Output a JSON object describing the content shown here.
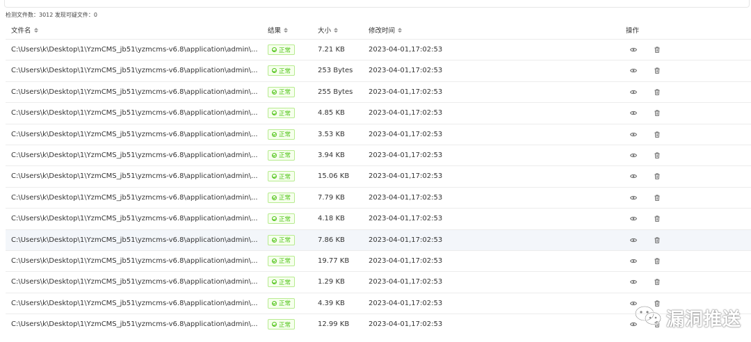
{
  "summary": "检测文件数：3012 发现可疑文件：0",
  "columns": {
    "name": "文件名",
    "result": "结果",
    "size": "大小",
    "time": "修改时间",
    "ops": "操作"
  },
  "rows": [
    {
      "path": "C:\\Users\\k\\Desktop\\1\\YzmCMS_jb51\\yzmcms-v6.8\\application\\admin\\...",
      "result": "正常",
      "size": "7.21 KB",
      "time": "2023-04-01,17:02:53"
    },
    {
      "path": "C:\\Users\\k\\Desktop\\1\\YzmCMS_jb51\\yzmcms-v6.8\\application\\admin\\...",
      "result": "正常",
      "size": "253 Bytes",
      "time": "2023-04-01,17:02:53"
    },
    {
      "path": "C:\\Users\\k\\Desktop\\1\\YzmCMS_jb51\\yzmcms-v6.8\\application\\admin\\...",
      "result": "正常",
      "size": "255 Bytes",
      "time": "2023-04-01,17:02:53"
    },
    {
      "path": "C:\\Users\\k\\Desktop\\1\\YzmCMS_jb51\\yzmcms-v6.8\\application\\admin\\...",
      "result": "正常",
      "size": "4.85 KB",
      "time": "2023-04-01,17:02:53"
    },
    {
      "path": "C:\\Users\\k\\Desktop\\1\\YzmCMS_jb51\\yzmcms-v6.8\\application\\admin\\...",
      "result": "正常",
      "size": "3.53 KB",
      "time": "2023-04-01,17:02:53"
    },
    {
      "path": "C:\\Users\\k\\Desktop\\1\\YzmCMS_jb51\\yzmcms-v6.8\\application\\admin\\...",
      "result": "正常",
      "size": "3.94 KB",
      "time": "2023-04-01,17:02:53"
    },
    {
      "path": "C:\\Users\\k\\Desktop\\1\\YzmCMS_jb51\\yzmcms-v6.8\\application\\admin\\...",
      "result": "正常",
      "size": "15.06 KB",
      "time": "2023-04-01,17:02:53"
    },
    {
      "path": "C:\\Users\\k\\Desktop\\1\\YzmCMS_jb51\\yzmcms-v6.8\\application\\admin\\...",
      "result": "正常",
      "size": "7.79 KB",
      "time": "2023-04-01,17:02:53"
    },
    {
      "path": "C:\\Users\\k\\Desktop\\1\\YzmCMS_jb51\\yzmcms-v6.8\\application\\admin\\...",
      "result": "正常",
      "size": "4.18 KB",
      "time": "2023-04-01,17:02:53"
    },
    {
      "path": "C:\\Users\\k\\Desktop\\1\\YzmCMS_jb51\\yzmcms-v6.8\\application\\admin\\...",
      "result": "正常",
      "size": "7.86 KB",
      "time": "2023-04-01,17:02:53"
    },
    {
      "path": "C:\\Users\\k\\Desktop\\1\\YzmCMS_jb51\\yzmcms-v6.8\\application\\admin\\...",
      "result": "正常",
      "size": "19.77 KB",
      "time": "2023-04-01,17:02:53"
    },
    {
      "path": "C:\\Users\\k\\Desktop\\1\\YzmCMS_jb51\\yzmcms-v6.8\\application\\admin\\...",
      "result": "正常",
      "size": "1.29 KB",
      "time": "2023-04-01,17:02:53"
    },
    {
      "path": "C:\\Users\\k\\Desktop\\1\\YzmCMS_jb51\\yzmcms-v6.8\\application\\admin\\...",
      "result": "正常",
      "size": "4.39 KB",
      "time": "2023-04-01,17:02:53"
    },
    {
      "path": "C:\\Users\\k\\Desktop\\1\\YzmCMS_jb51\\yzmcms-v6.8\\application\\admin\\...",
      "result": "正常",
      "size": "12.99 KB",
      "time": "2023-04-01,17:02:53"
    }
  ],
  "highlighted_row": 9,
  "icons": {
    "view": "eye-icon",
    "delete": "trash-icon",
    "sort": "sort-icon",
    "status": "check-circle-icon"
  },
  "colors": {
    "status_text": "#52c41a",
    "status_bg": "#f6ffed",
    "status_border": "#b7eb8f",
    "row_highlight": "#f3f6fa"
  },
  "watermark": {
    "text": "漏洞推送",
    "icon": "wechat-icon"
  }
}
